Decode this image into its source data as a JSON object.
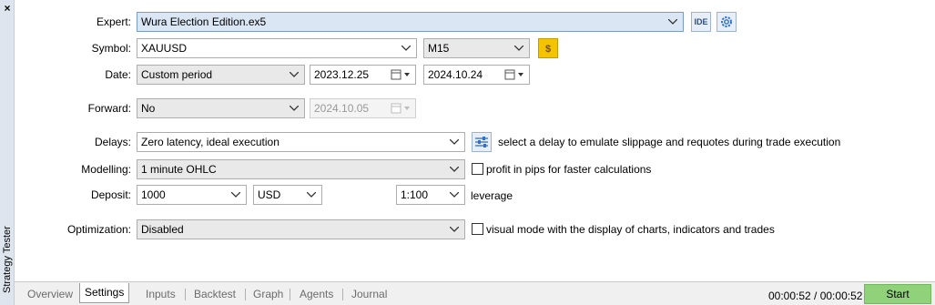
{
  "window": {
    "side_title": "Strategy Tester",
    "close_glyph": "×"
  },
  "settings": {
    "expert": {
      "label": "Expert:",
      "value": "Wura Election Edition.ex5",
      "ide_label": "IDE"
    },
    "symbol": {
      "label": "Symbol:",
      "value": "XAUUSD",
      "timeframe": "M15"
    },
    "date": {
      "label": "Date:",
      "mode": "Custom period",
      "from": "2023.12.25",
      "to": "2024.10.24"
    },
    "forward": {
      "label": "Forward:",
      "value": "No",
      "date": "2024.10.05"
    },
    "delays": {
      "label": "Delays:",
      "value": "Zero latency, ideal execution",
      "hint": "select a delay to emulate slippage and requotes during trade execution"
    },
    "modelling": {
      "label": "Modelling:",
      "value": "1 minute OHLC",
      "checkbox_label": "profit in pips for faster calculations"
    },
    "deposit": {
      "label": "Deposit:",
      "amount": "1000",
      "currency": "USD",
      "leverage": "1:100",
      "leverage_label": "leverage"
    },
    "optimization": {
      "label": "Optimization:",
      "value": "Disabled",
      "checkbox_label": "visual mode with the display of charts, indicators and trades"
    }
  },
  "tabs": [
    "Overview",
    "Settings",
    "Inputs",
    "Backtest",
    "Graph",
    "Agents",
    "Journal"
  ],
  "active_tab": "Settings",
  "status": {
    "timer": "00:00:52 / 00:00:52",
    "start_label": "Start"
  },
  "colors": {
    "start_bg": "#8fd27a",
    "side_strip": "#dfe5ee",
    "symbol_icon": "#f5c400"
  }
}
